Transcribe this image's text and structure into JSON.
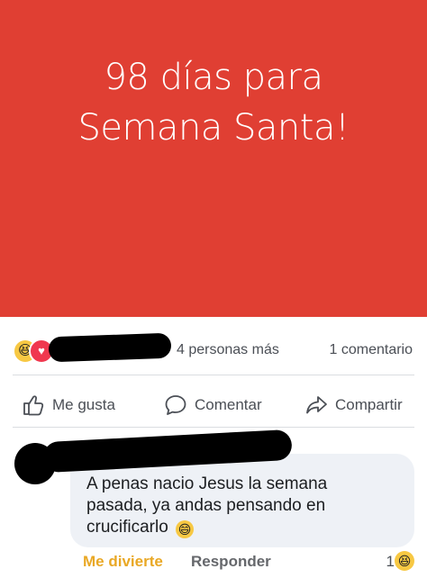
{
  "post": {
    "text_line1": "98 días para",
    "text_line2": "Semana Santa!",
    "background_color": "#e03f33"
  },
  "stats": {
    "reaction_icons": [
      "haha-icon",
      "love-icon"
    ],
    "others_text": "4 personas más",
    "comments_text": "1 comentario"
  },
  "actions": {
    "like_label": "Me gusta",
    "comment_label": "Comentar",
    "share_label": "Compartir"
  },
  "comment": {
    "text": "A penas nacio Jesus la semana pasada, ya andas pensando en crucificarlo",
    "reaction_label": "Me divierte",
    "reply_label": "Responder",
    "reaction_count": "1",
    "reaction_icon": "haha-icon"
  }
}
